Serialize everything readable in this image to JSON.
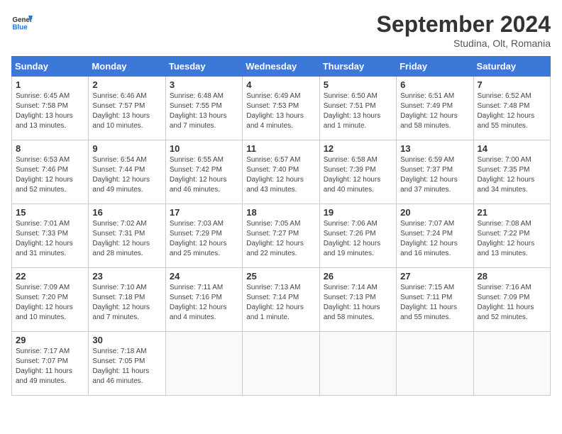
{
  "header": {
    "logo_line1": "General",
    "logo_line2": "Blue",
    "month_year": "September 2024",
    "location": "Studina, Olt, Romania"
  },
  "weekdays": [
    "Sunday",
    "Monday",
    "Tuesday",
    "Wednesday",
    "Thursday",
    "Friday",
    "Saturday"
  ],
  "weeks": [
    [
      {
        "day": "1",
        "info": "Sunrise: 6:45 AM\nSunset: 7:58 PM\nDaylight: 13 hours\nand 13 minutes."
      },
      {
        "day": "2",
        "info": "Sunrise: 6:46 AM\nSunset: 7:57 PM\nDaylight: 13 hours\nand 10 minutes."
      },
      {
        "day": "3",
        "info": "Sunrise: 6:48 AM\nSunset: 7:55 PM\nDaylight: 13 hours\nand 7 minutes."
      },
      {
        "day": "4",
        "info": "Sunrise: 6:49 AM\nSunset: 7:53 PM\nDaylight: 13 hours\nand 4 minutes."
      },
      {
        "day": "5",
        "info": "Sunrise: 6:50 AM\nSunset: 7:51 PM\nDaylight: 13 hours\nand 1 minute."
      },
      {
        "day": "6",
        "info": "Sunrise: 6:51 AM\nSunset: 7:49 PM\nDaylight: 12 hours\nand 58 minutes."
      },
      {
        "day": "7",
        "info": "Sunrise: 6:52 AM\nSunset: 7:48 PM\nDaylight: 12 hours\nand 55 minutes."
      }
    ],
    [
      {
        "day": "8",
        "info": "Sunrise: 6:53 AM\nSunset: 7:46 PM\nDaylight: 12 hours\nand 52 minutes."
      },
      {
        "day": "9",
        "info": "Sunrise: 6:54 AM\nSunset: 7:44 PM\nDaylight: 12 hours\nand 49 minutes."
      },
      {
        "day": "10",
        "info": "Sunrise: 6:55 AM\nSunset: 7:42 PM\nDaylight: 12 hours\nand 46 minutes."
      },
      {
        "day": "11",
        "info": "Sunrise: 6:57 AM\nSunset: 7:40 PM\nDaylight: 12 hours\nand 43 minutes."
      },
      {
        "day": "12",
        "info": "Sunrise: 6:58 AM\nSunset: 7:39 PM\nDaylight: 12 hours\nand 40 minutes."
      },
      {
        "day": "13",
        "info": "Sunrise: 6:59 AM\nSunset: 7:37 PM\nDaylight: 12 hours\nand 37 minutes."
      },
      {
        "day": "14",
        "info": "Sunrise: 7:00 AM\nSunset: 7:35 PM\nDaylight: 12 hours\nand 34 minutes."
      }
    ],
    [
      {
        "day": "15",
        "info": "Sunrise: 7:01 AM\nSunset: 7:33 PM\nDaylight: 12 hours\nand 31 minutes."
      },
      {
        "day": "16",
        "info": "Sunrise: 7:02 AM\nSunset: 7:31 PM\nDaylight: 12 hours\nand 28 minutes."
      },
      {
        "day": "17",
        "info": "Sunrise: 7:03 AM\nSunset: 7:29 PM\nDaylight: 12 hours\nand 25 minutes."
      },
      {
        "day": "18",
        "info": "Sunrise: 7:05 AM\nSunset: 7:27 PM\nDaylight: 12 hours\nand 22 minutes."
      },
      {
        "day": "19",
        "info": "Sunrise: 7:06 AM\nSunset: 7:26 PM\nDaylight: 12 hours\nand 19 minutes."
      },
      {
        "day": "20",
        "info": "Sunrise: 7:07 AM\nSunset: 7:24 PM\nDaylight: 12 hours\nand 16 minutes."
      },
      {
        "day": "21",
        "info": "Sunrise: 7:08 AM\nSunset: 7:22 PM\nDaylight: 12 hours\nand 13 minutes."
      }
    ],
    [
      {
        "day": "22",
        "info": "Sunrise: 7:09 AM\nSunset: 7:20 PM\nDaylight: 12 hours\nand 10 minutes."
      },
      {
        "day": "23",
        "info": "Sunrise: 7:10 AM\nSunset: 7:18 PM\nDaylight: 12 hours\nand 7 minutes."
      },
      {
        "day": "24",
        "info": "Sunrise: 7:11 AM\nSunset: 7:16 PM\nDaylight: 12 hours\nand 4 minutes."
      },
      {
        "day": "25",
        "info": "Sunrise: 7:13 AM\nSunset: 7:14 PM\nDaylight: 12 hours\nand 1 minute."
      },
      {
        "day": "26",
        "info": "Sunrise: 7:14 AM\nSunset: 7:13 PM\nDaylight: 11 hours\nand 58 minutes."
      },
      {
        "day": "27",
        "info": "Sunrise: 7:15 AM\nSunset: 7:11 PM\nDaylight: 11 hours\nand 55 minutes."
      },
      {
        "day": "28",
        "info": "Sunrise: 7:16 AM\nSunset: 7:09 PM\nDaylight: 11 hours\nand 52 minutes."
      }
    ],
    [
      {
        "day": "29",
        "info": "Sunrise: 7:17 AM\nSunset: 7:07 PM\nDaylight: 11 hours\nand 49 minutes."
      },
      {
        "day": "30",
        "info": "Sunrise: 7:18 AM\nSunset: 7:05 PM\nDaylight: 11 hours\nand 46 minutes."
      },
      {
        "day": "",
        "info": ""
      },
      {
        "day": "",
        "info": ""
      },
      {
        "day": "",
        "info": ""
      },
      {
        "day": "",
        "info": ""
      },
      {
        "day": "",
        "info": ""
      }
    ]
  ]
}
